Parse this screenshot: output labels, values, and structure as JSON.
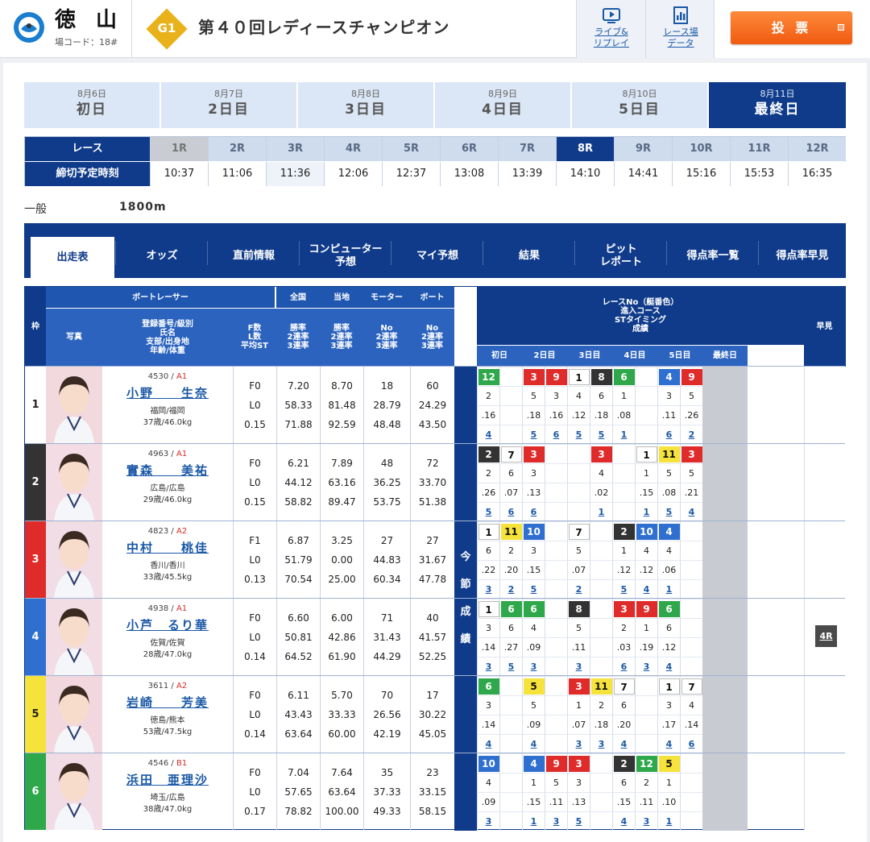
{
  "header": {
    "venue_name": "徳 山",
    "venue_code": "場コード：18#",
    "grade": "G1",
    "race_title": "第４０回レディースチャンピオン",
    "live_link": "ライブ&\nリプレイ",
    "data_link": "レース場\nデータ",
    "vote_button": "投 票"
  },
  "days": [
    {
      "date": "8月6日",
      "label": "初日"
    },
    {
      "date": "8月7日",
      "label": "2日目"
    },
    {
      "date": "8月8日",
      "label": "3日目"
    },
    {
      "date": "8月9日",
      "label": "4日目"
    },
    {
      "date": "8月10日",
      "label": "5日目"
    },
    {
      "date": "8月11日",
      "label": "最終日"
    }
  ],
  "race_table": {
    "race_label": "レース",
    "time_label": "締切予定時刻",
    "races": [
      "1R",
      "2R",
      "3R",
      "4R",
      "5R",
      "6R",
      "7R",
      "8R",
      "9R",
      "10R",
      "11R",
      "12R"
    ],
    "times": [
      "10:37",
      "11:06",
      "11:36",
      "12:06",
      "12:37",
      "13:08",
      "13:39",
      "14:10",
      "14:41",
      "15:16",
      "15:53",
      "16:35"
    ]
  },
  "race_info": {
    "type": "一般",
    "distance": "1800m"
  },
  "nav_tabs": [
    "出走表",
    "オッズ",
    "直前情報",
    "コンピューター\n予想",
    "マイ予想",
    "結果",
    "ピット\nレポート",
    "得点率一覧",
    "得点率早見"
  ],
  "table_headers": {
    "frame": "枠",
    "boat_racer": "ボートレーサー",
    "photo": "写真",
    "racer_info": "登録番号/級別\n氏名\n支部/出身地\n年齢/体重",
    "fl": "F数\nL数\n平均ST",
    "national": "全国",
    "local": "当地",
    "motor": "モーター",
    "boat": "ボート",
    "rate_sub": "勝率\n2連率\n3連率",
    "no_sub": "No\n2連率\n3連率",
    "series_title": "レースNo（艇番色）\n進入コース\nSTタイミング\n成績",
    "series_days": [
      "初日",
      "2日目",
      "3日目",
      "4日目",
      "5日目",
      "最終日"
    ],
    "hayami": "早見",
    "ima": [
      "今",
      "節",
      "成",
      "績"
    ]
  },
  "racers": [
    {
      "reg": "4530",
      "cls": "A1",
      "name": "小野　　生奈",
      "branch": "福岡/福岡",
      "age": "37歳/46.0kg",
      "f": "F0",
      "l": "L0",
      "st": "0.15",
      "nat": [
        "7.20",
        "58.33",
        "71.88"
      ],
      "loc": [
        "8.70",
        "81.48",
        "92.59"
      ],
      "mot": [
        "18",
        "28.79",
        "48.48"
      ],
      "boat": [
        "60",
        "24.29",
        "43.50"
      ],
      "series": [
        [
          "12",
          "2",
          ".16",
          "4"
        ],
        [
          "",
          "",
          "",
          ""
        ],
        [
          "3",
          "5",
          ".18",
          "5"
        ],
        [
          "9",
          "3",
          ".16",
          "6"
        ],
        [
          "1",
          "4",
          ".12",
          "5"
        ],
        [
          "8",
          "6",
          ".18",
          "5"
        ],
        [
          "6",
          "1",
          ".08",
          "1"
        ],
        [
          "",
          "",
          "",
          ""
        ],
        [
          "4",
          "3",
          ".11",
          "6"
        ],
        [
          "9",
          "5",
          ".26",
          "2"
        ]
      ],
      "hayami": ""
    },
    {
      "reg": "4963",
      "cls": "A1",
      "name": "實森　　美祐",
      "branch": "広島/広島",
      "age": "29歳/46.0kg",
      "f": "F0",
      "l": "L0",
      "st": "0.15",
      "nat": [
        "6.21",
        "44.12",
        "58.82"
      ],
      "loc": [
        "7.89",
        "63.16",
        "89.47"
      ],
      "mot": [
        "48",
        "36.25",
        "53.75"
      ],
      "boat": [
        "72",
        "33.70",
        "51.38"
      ],
      "series": [
        [
          "2",
          "2",
          ".26",
          "5"
        ],
        [
          "7",
          "6",
          ".07",
          "6"
        ],
        [
          "3",
          "3",
          ".13",
          "6"
        ],
        [
          "",
          "",
          "",
          ""
        ],
        [
          "",
          "",
          "",
          ""
        ],
        [
          "3",
          "4",
          ".02",
          "1"
        ],
        [
          "",
          "",
          "",
          ""
        ],
        [
          "1",
          "1",
          ".15",
          "1"
        ],
        [
          "11",
          "5",
          ".08",
          "5"
        ],
        [
          "3",
          "5",
          ".21",
          "4"
        ]
      ],
      "hayami": ""
    },
    {
      "reg": "4823",
      "cls": "A2",
      "name": "中村　　桃佳",
      "branch": "香川/香川",
      "age": "33歳/45.5kg",
      "f": "F1",
      "l": "L0",
      "st": "0.13",
      "nat": [
        "6.87",
        "51.79",
        "70.54"
      ],
      "loc": [
        "3.25",
        "0.00",
        "25.00"
      ],
      "mot": [
        "27",
        "44.83",
        "60.34"
      ],
      "boat": [
        "27",
        "31.67",
        "47.78"
      ],
      "series": [
        [
          "1",
          "6",
          ".22",
          "3"
        ],
        [
          "11",
          "2",
          ".20",
          "2"
        ],
        [
          "10",
          "3",
          ".15",
          "5"
        ],
        [
          "",
          "",
          "",
          ""
        ],
        [
          "7",
          "5",
          ".07",
          "2"
        ],
        [
          "",
          "",
          "",
          ""
        ],
        [
          "2",
          "1",
          ".12",
          "5"
        ],
        [
          "10",
          "4",
          ".12",
          "4"
        ],
        [
          "4",
          "4",
          ".06",
          "1"
        ],
        [
          "",
          "",
          "",
          ""
        ]
      ],
      "hayami": ""
    },
    {
      "reg": "4938",
      "cls": "A1",
      "name": "小芦　るり華",
      "branch": "佐賀/佐賀",
      "age": "28歳/47.0kg",
      "f": "F0",
      "l": "L0",
      "st": "0.14",
      "nat": [
        "6.60",
        "50.81",
        "64.52"
      ],
      "loc": [
        "6.00",
        "42.86",
        "61.90"
      ],
      "mot": [
        "71",
        "31.43",
        "44.29"
      ],
      "boat": [
        "40",
        "41.57",
        "52.25"
      ],
      "series": [
        [
          "1",
          "3",
          ".14",
          "3"
        ],
        [
          "6",
          "6",
          ".27",
          "5"
        ],
        [
          "6",
          "4",
          ".09",
          "3"
        ],
        [
          "",
          "",
          "",
          ""
        ],
        [
          "8",
          "5",
          ".11",
          "3"
        ],
        [
          "",
          "",
          "",
          ""
        ],
        [
          "3",
          "2",
          ".03",
          "6"
        ],
        [
          "9",
          "1",
          ".19",
          "3"
        ],
        [
          "6",
          "6",
          ".12",
          "4"
        ],
        [
          "",
          "",
          "",
          ""
        ]
      ],
      "hayami": "4R"
    },
    {
      "reg": "3611",
      "cls": "A2",
      "name": "岩崎　　芳美",
      "branch": "徳島/熊本",
      "age": "53歳/47.5kg",
      "f": "F0",
      "l": "L0",
      "st": "0.14",
      "nat": [
        "6.11",
        "43.43",
        "63.64"
      ],
      "loc": [
        "5.70",
        "33.33",
        "60.00"
      ],
      "mot": [
        "70",
        "26.56",
        "42.19"
      ],
      "boat": [
        "17",
        "30.22",
        "45.05"
      ],
      "series": [
        [
          "6",
          "3",
          ".14",
          "4"
        ],
        [
          "",
          "",
          "",
          ""
        ],
        [
          "5",
          "5",
          ".09",
          "4"
        ],
        [
          "",
          "",
          "",
          ""
        ],
        [
          "3",
          "1",
          ".07",
          "3"
        ],
        [
          "11",
          "2",
          ".18",
          "3"
        ],
        [
          "7",
          "6",
          ".20",
          "4"
        ],
        [
          "",
          "",
          "",
          ""
        ],
        [
          "1",
          "3",
          ".17",
          "4"
        ],
        [
          "7",
          "4",
          ".14",
          "6"
        ]
      ],
      "hayami": ""
    },
    {
      "reg": "4546",
      "cls": "B1",
      "name": "浜田　亜理沙",
      "branch": "埼玉/広島",
      "age": "38歳/47.0kg",
      "f": "F0",
      "l": "L0",
      "st": "0.17",
      "nat": [
        "7.04",
        "57.65",
        "78.82"
      ],
      "loc": [
        "7.64",
        "63.64",
        "100.00"
      ],
      "mot": [
        "35",
        "37.33",
        "49.33"
      ],
      "boat": [
        "23",
        "33.15",
        "58.15"
      ],
      "series": [
        [
          "10",
          "4",
          ".09",
          "3"
        ],
        [
          "",
          "",
          "",
          ""
        ],
        [
          "4",
          "1",
          ".15",
          "1"
        ],
        [
          "9",
          "5",
          ".11",
          "3"
        ],
        [
          "3",
          "3",
          ".13",
          "5"
        ],
        [
          "",
          "",
          "",
          ""
        ],
        [
          "2",
          "6",
          ".15",
          "4"
        ],
        [
          "12",
          "2",
          ".11",
          "3"
        ],
        [
          "5",
          "1",
          ".10",
          "1"
        ],
        [
          "",
          "",
          "",
          ""
        ]
      ],
      "hayami": ""
    }
  ],
  "colors": {
    "frame": [
      "#ffffff",
      "#333333",
      "#e02b2b",
      "#2e6fd0",
      "#f5e23a",
      "#2ea84a"
    ],
    "navy": "#0f3b8a",
    "accent": "#f05a10"
  },
  "icons": {
    "venue_logo": "tokuyama-logo",
    "grade": "g1-diamond-badge",
    "live": "tv-icon",
    "data": "chart-document-icon"
  }
}
